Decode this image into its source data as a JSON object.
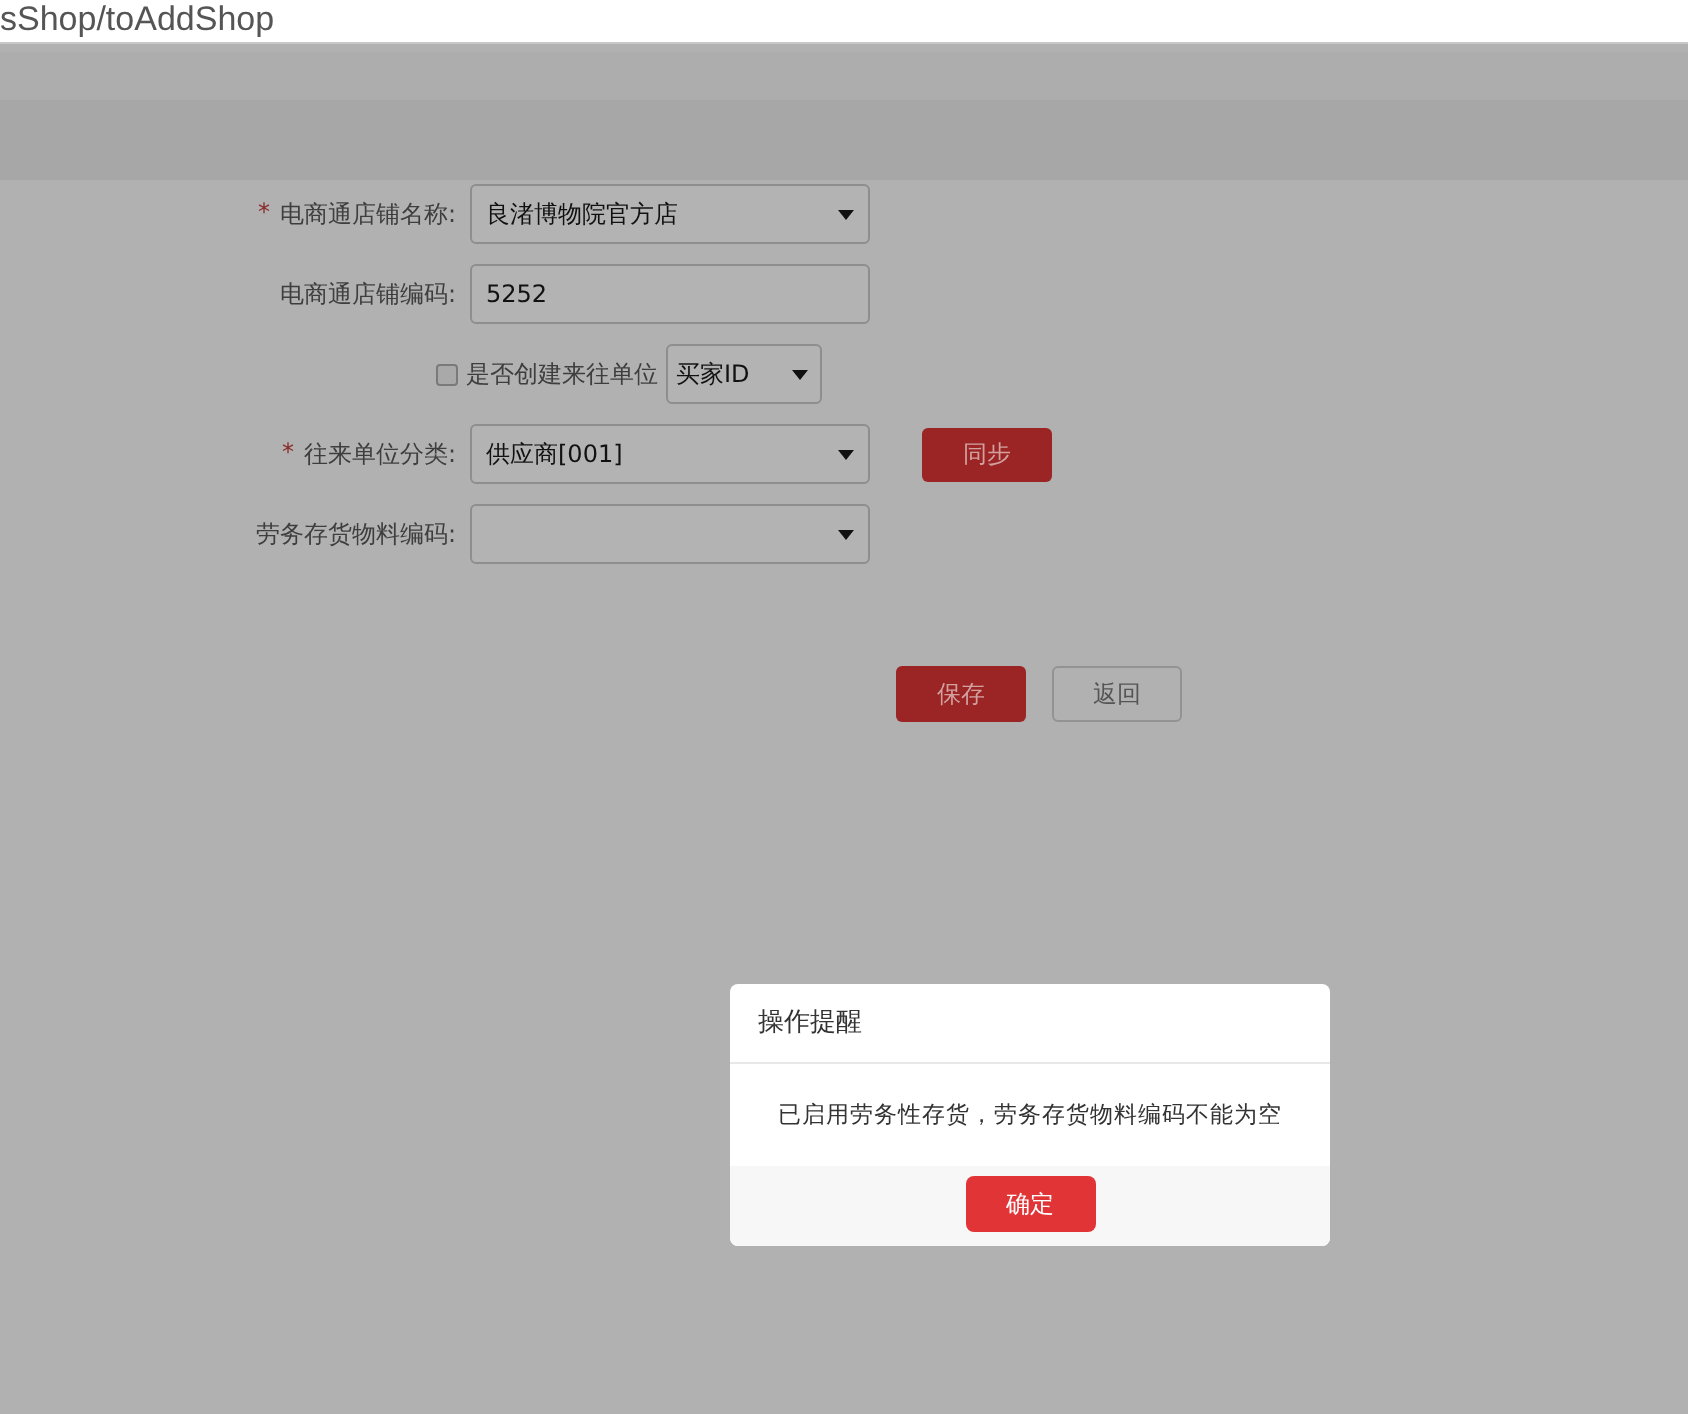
{
  "address_bar": {
    "url": "sShop/toAddShop"
  },
  "form": {
    "fields": [
      {
        "kind": "select",
        "required_mark": "*",
        "label": "电商通店铺名称:",
        "value": "良渚博物院官方店"
      },
      {
        "kind": "input",
        "label": "电商通店铺编码:",
        "value": "5252"
      },
      {
        "kind": "checkbox",
        "label": "是否创建来往单位",
        "checked": false,
        "select_value": "买家ID"
      },
      {
        "kind": "select",
        "required_mark": "*",
        "label": "往来单位分类:",
        "value": "供应商[001]",
        "button": "同步"
      },
      {
        "kind": "select",
        "label": "劳务存货物料编码:"
      }
    ],
    "buttons": [
      {
        "kind": "primary",
        "label": "保存"
      },
      {
        "kind": "secondary",
        "label": "返回"
      }
    ]
  },
  "dialog": {
    "title": "操作提醒",
    "message": "已启用劳务性存货，劳务存货物料编码不能为空",
    "button": "确定"
  }
}
